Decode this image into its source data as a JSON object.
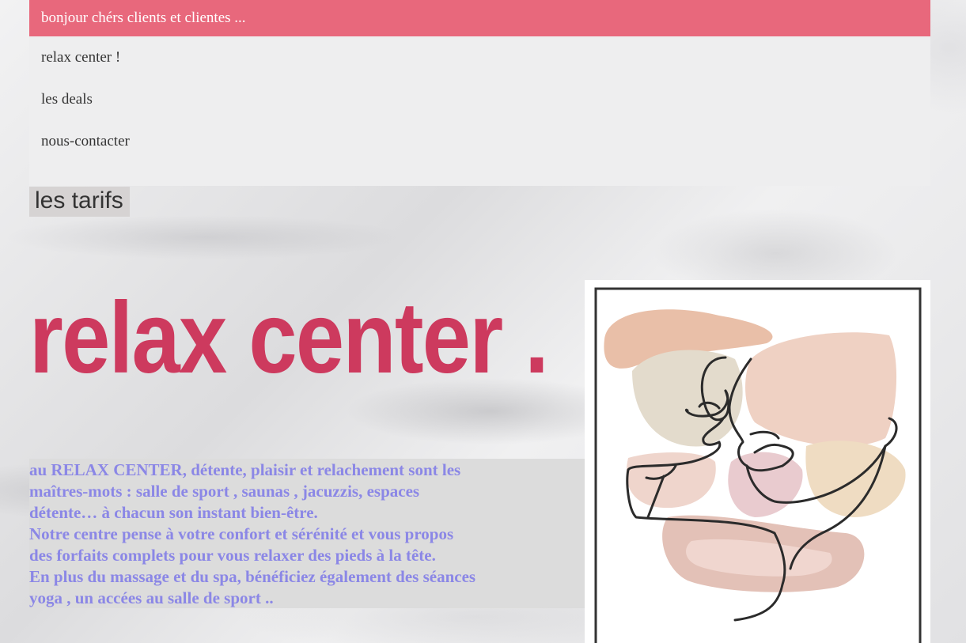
{
  "topbar": {
    "greeting": "bonjour chérs clients et clientes ..."
  },
  "nav": {
    "items": [
      {
        "label": "relax center !"
      },
      {
        "label": "les deals"
      },
      {
        "label": "nous-contacter"
      }
    ]
  },
  "tarifs": {
    "label": "les tarifs"
  },
  "hero": {
    "title": "relax center ."
  },
  "description": {
    "lines": [
      "au RELAX CENTER, détente, plaisir et relachement sont les",
      "maîtres-mots : salle de sport , saunas , jacuzzis, espaces",
      "détente… à chacun son instant bien-être.",
      "Notre centre pense à votre confort et sérénité et vous propos",
      "des forfaits complets pour vous relaxer des pieds à la tête.",
      "En plus du massage et du spa, bénéficiez également des séances",
      "yoga , un accées au salle de sport .."
    ]
  },
  "colors": {
    "topbar": "#e8687c",
    "hero_text": "#cd3a5e",
    "description_text": "#8b87e6"
  }
}
